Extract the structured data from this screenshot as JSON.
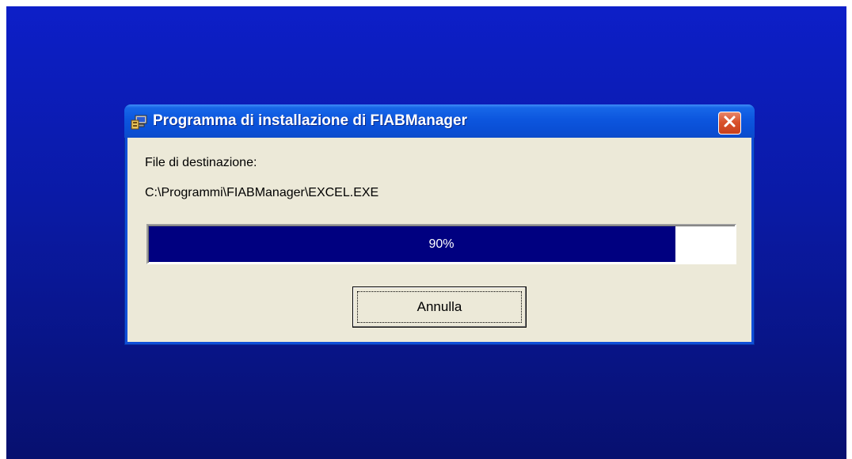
{
  "window": {
    "title": "Programma di installazione di FIABManager",
    "icon": "installer-computer-icon",
    "close_icon": "close-icon"
  },
  "content": {
    "destination_label": "File di destinazione:",
    "destination_path": "C:\\Programmi\\FIABManager\\EXCEL.EXE"
  },
  "progress": {
    "value": 0.9,
    "text": "90%"
  },
  "buttons": {
    "cancel_label": "Annulla"
  },
  "colors": {
    "desktop_background": "#0a1aa4",
    "titlebar": "#0a4fd6",
    "close_button": "#d9522c",
    "dialog_face": "#ece9d8",
    "progress_fill": "#000080"
  }
}
